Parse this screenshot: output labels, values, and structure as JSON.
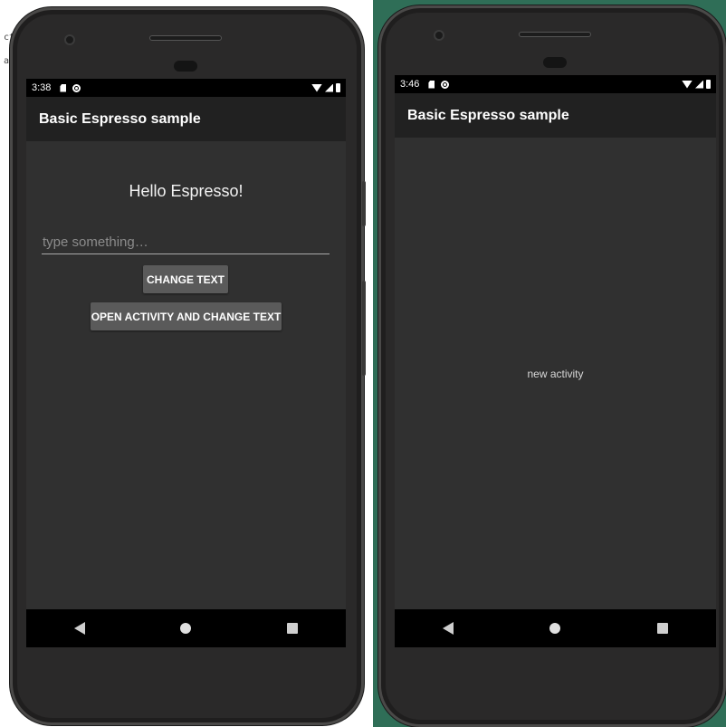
{
  "background_fragments": [
    "ct",
    "a"
  ],
  "left_phone": {
    "status": {
      "time": "3:38"
    },
    "appbar": {
      "title": "Basic Espresso sample"
    },
    "content": {
      "hello_text": "Hello Espresso!",
      "input": {
        "placeholder": "type something…",
        "value": ""
      },
      "change_text_button": "CHANGE TEXT",
      "open_activity_button": "OPEN ACTIVITY AND CHANGE TEXT"
    }
  },
  "right_phone": {
    "status": {
      "time": "3:46"
    },
    "appbar": {
      "title": "Basic Espresso sample"
    },
    "content": {
      "message": "new activity"
    }
  },
  "colors": {
    "appbar": "#212121",
    "screen_background": "#303030",
    "button": "#5a5a5a",
    "status_bar": "#000000"
  },
  "icons": {
    "status_left": [
      "sd-card-icon",
      "sync-icon"
    ],
    "status_right": [
      "wifi-icon",
      "signal-icon",
      "battery-icon"
    ],
    "nav": [
      "back-icon",
      "home-icon",
      "recents-icon"
    ]
  }
}
